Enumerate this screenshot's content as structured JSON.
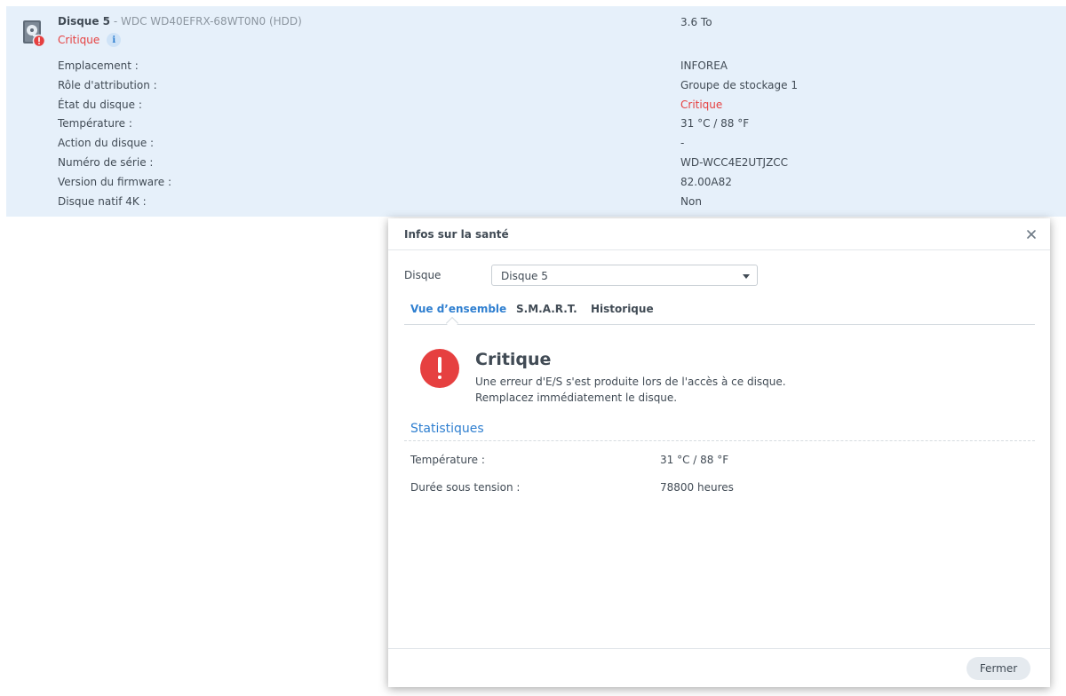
{
  "disk": {
    "name": "Disque 5",
    "model": " - WDC WD40EFRX-68WT0N0 (HDD)",
    "size": "3.6 To",
    "status": "Critique",
    "properties": [
      {
        "label": "Emplacement :",
        "value": "INFOREA"
      },
      {
        "label": "Rôle d'attribution :",
        "value": "Groupe de stockage 1"
      },
      {
        "label": "État du disque :",
        "value": "Critique",
        "critical": true
      },
      {
        "label": "Température :",
        "value": "31 °C / 88 °F"
      },
      {
        "label": "Action du disque :",
        "value": "-"
      },
      {
        "label": "Numéro de série :",
        "value": "WD-WCC4E2UTJZCC"
      },
      {
        "label": "Version du firmware :",
        "value": "82.00A82"
      },
      {
        "label": "Disque natif 4K :",
        "value": "Non"
      }
    ]
  },
  "dialog": {
    "title": "Infos sur la santé",
    "disk_label": "Disque",
    "disk_selected": "Disque 5",
    "tabs": [
      "Vue d’ensemble",
      "S.M.A.R.T.",
      "Historique"
    ],
    "active_tab": 0,
    "status_heading": "Critique",
    "status_lines": [
      "Une erreur d'E/S s'est produite lors de l'accès à ce disque.",
      "Remplacez immédiatement le disque."
    ],
    "section_title": "Statistiques",
    "stats": [
      {
        "label": "Température :",
        "value": "31 °C / 88 °F"
      },
      {
        "label": "Durée sous tension :",
        "value": "78800 heures"
      }
    ],
    "close_button": "Fermer"
  },
  "colors": {
    "critical": "#e64040",
    "accent": "#2f7fd0",
    "panel_background": "#e6f0fa"
  },
  "icons": {
    "disk": "hard-drive-icon",
    "warning_badge": "error-badge-icon",
    "info": "info-icon",
    "close": "close-icon",
    "dropdown": "caret-down-icon",
    "status": "critical-exclamation-icon"
  }
}
